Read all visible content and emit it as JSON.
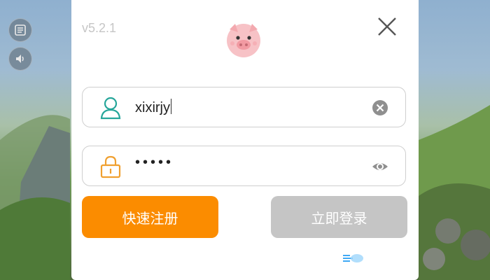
{
  "app": {
    "version": "v5.2.1"
  },
  "login": {
    "username_value": "xixirjy",
    "password_mask": "•••••",
    "register_label": "快速注册",
    "login_label": "立即登录"
  },
  "icons": {
    "menu": "list-icon",
    "sound": "speaker-icon",
    "logo": "pig-icon",
    "close": "close-icon",
    "user": "user-icon",
    "lock": "lock-icon",
    "clear": "clear-icon",
    "eye": "eye-icon"
  },
  "colors": {
    "register": "#fb8c00",
    "login_disabled": "#c5c5c5",
    "field_icon_user": "#26a69a",
    "field_icon_lock": "#f0a030"
  }
}
